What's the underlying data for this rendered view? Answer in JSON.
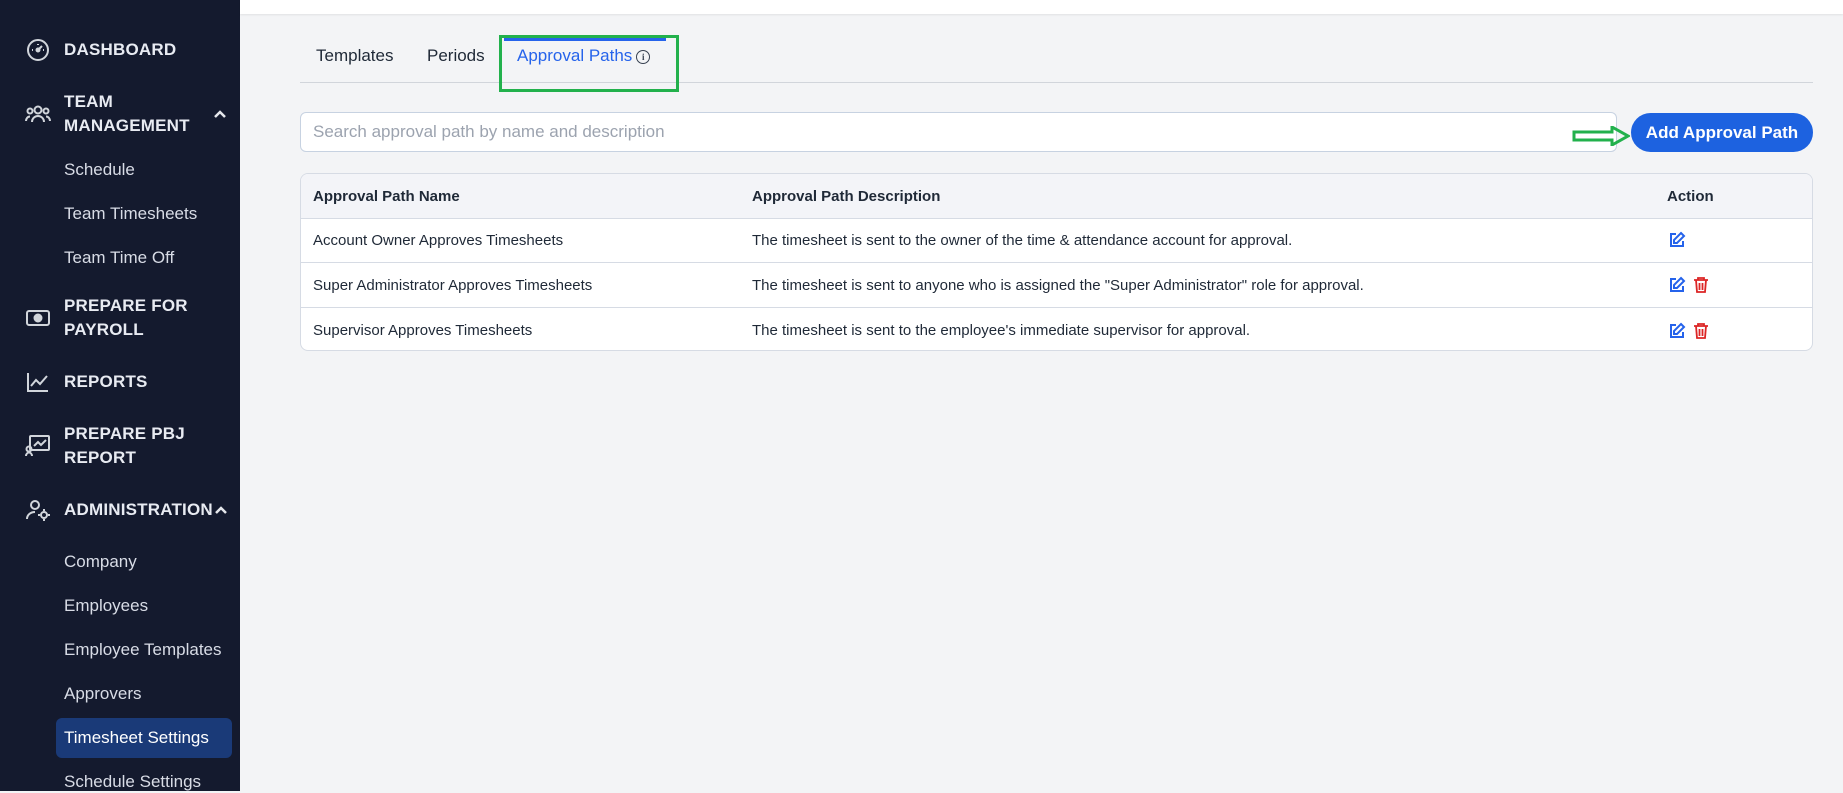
{
  "sidebar": {
    "dashboard": "DASHBOARD",
    "team_management_line1": "TEAM",
    "team_management_line2": "MANAGEMENT",
    "team_items": [
      "Schedule",
      "Team Timesheets",
      "Team Time Off"
    ],
    "payroll_line1": "PREPARE FOR",
    "payroll_line2": "PAYROLL",
    "reports": "REPORTS",
    "pbj_line1": "PREPARE PBJ",
    "pbj_line2": "REPORT",
    "administration": "ADMINISTRATION",
    "admin_items": [
      "Company",
      "Employees",
      "Employee Templates",
      "Approvers",
      "Timesheet Settings",
      "Schedule Settings"
    ]
  },
  "tabs": {
    "templates": "Templates",
    "periods": "Periods",
    "approval_paths": "Approval Paths",
    "info_glyph": "i"
  },
  "search": {
    "placeholder": "Search approval path by name and description",
    "value": ""
  },
  "toolbar": {
    "add_label": "Add Approval Path"
  },
  "table": {
    "headers": {
      "name": "Approval Path Name",
      "description": "Approval Path Description",
      "action": "Action"
    },
    "rows": [
      {
        "name": "Account Owner Approves Timesheets",
        "description": "The timesheet is sent to the owner of the time & attendance account for approval.",
        "deletable": false
      },
      {
        "name": "Super Administrator Approves Timesheets",
        "description": "The timesheet is sent to anyone who is assigned the \"Super Administrator\" role for approval.",
        "deletable": true
      },
      {
        "name": "Supervisor Approves Timesheets",
        "description": "The timesheet is sent to the employee's immediate supervisor for approval.",
        "deletable": true
      }
    ]
  },
  "colors": {
    "sidebar_bg": "#141a2e",
    "accent": "#2563eb",
    "annotation": "#22b14c",
    "delete": "#dc2626"
  }
}
